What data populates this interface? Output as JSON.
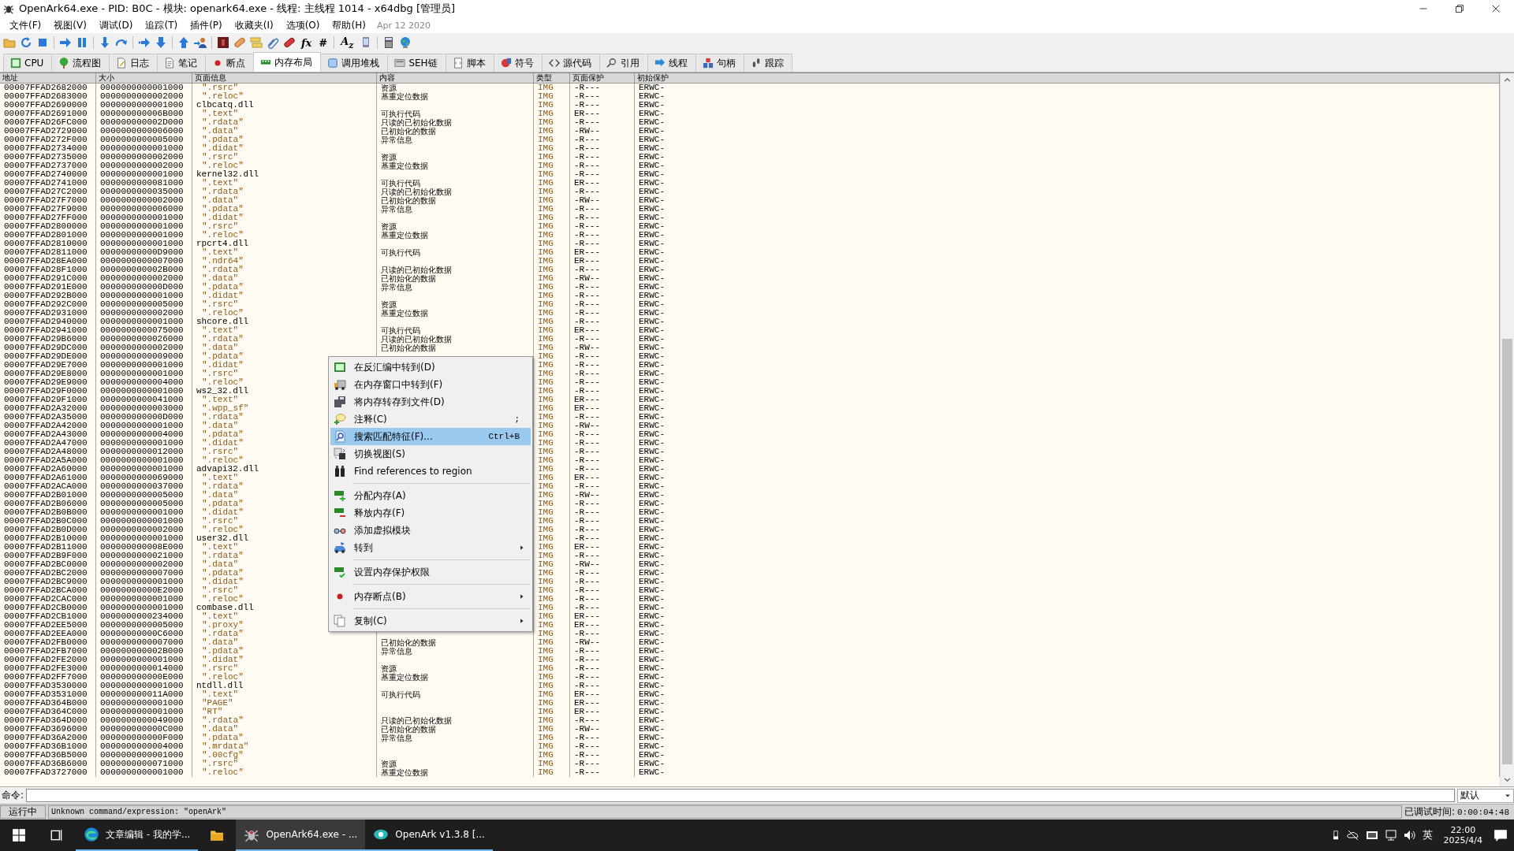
{
  "window": {
    "title": "OpenArk64.exe - PID: B0C - 模块: openark64.exe - 线程: 主线程 1014 - x64dbg [管理员]"
  },
  "menu_bar": {
    "items": [
      "文件(F)",
      "视图(V)",
      "调试(D)",
      "追踪(T)",
      "插件(P)",
      "收藏夹(I)",
      "选项(O)",
      "帮助(H)"
    ],
    "build_date": "Apr 12 2020"
  },
  "toolbar": [
    {
      "kind": "icon"
    },
    {
      "kind": "icon"
    },
    {
      "kind": "icon"
    },
    {
      "kind": "separator"
    },
    {
      "kind": "icon"
    },
    {
      "kind": "icon"
    },
    {
      "kind": "separator"
    },
    {
      "kind": "icon"
    },
    {
      "kind": "icon"
    },
    {
      "kind": "separator"
    },
    {
      "kind": "icon"
    },
    {
      "kind": "icon"
    },
    {
      "kind": "separator"
    },
    {
      "kind": "icon"
    },
    {
      "kind": "icon"
    },
    {
      "kind": "separator"
    },
    {
      "kind": "icon"
    },
    {
      "kind": "icon"
    },
    {
      "kind": "icon"
    },
    {
      "kind": "icon"
    },
    {
      "kind": "icon"
    },
    {
      "kind": "glyph",
      "text": "fx"
    },
    {
      "kind": "glyph",
      "text": "#"
    },
    {
      "kind": "separator"
    },
    {
      "kind": "glyph",
      "text": "A$_{z}$"
    },
    {
      "kind": "icon"
    },
    {
      "kind": "separator"
    },
    {
      "kind": "icon"
    },
    {
      "kind": "icon"
    }
  ],
  "tabs": [
    {
      "label": "CPU",
      "selected": false
    },
    {
      "label": "流程图",
      "selected": false
    },
    {
      "label": "日志",
      "selected": false
    },
    {
      "label": "笔记",
      "selected": false
    },
    {
      "label": "断点",
      "selected": false
    },
    {
      "label": "内存布局",
      "selected": true
    },
    {
      "label": "调用堆栈",
      "selected": false
    },
    {
      "label": "SEH链",
      "selected": false
    },
    {
      "label": "脚本",
      "selected": false
    },
    {
      "label": "符号",
      "selected": false
    },
    {
      "label": "源代码",
      "selected": false
    },
    {
      "label": "引用",
      "selected": false
    },
    {
      "label": "线程",
      "selected": false
    },
    {
      "label": "句柄",
      "selected": false
    },
    {
      "label": "跟踪",
      "selected": false
    }
  ],
  "table": {
    "columns": [
      "地址",
      "大小",
      "页面信息",
      "内容",
      "类型",
      "页面保护",
      "初始保护"
    ],
    "rows": [
      {
        "address": "00007FFAD2682000",
        "size": "0000000000001000",
        "info": "\".rsrc\"",
        "kind": "section",
        "content": "资源",
        "type": "IMG",
        "protection": "-R---",
        "initial": "ERWC-"
      },
      {
        "address": "00007FFAD2683000",
        "size": "0000000000002000",
        "info": "\".reloc\"",
        "kind": "section",
        "content": "基重定位数据",
        "type": "IMG",
        "protection": "-R---",
        "initial": "ERWC-"
      },
      {
        "address": "00007FFAD2690000",
        "size": "0000000000001000",
        "info": "clbcatq.dll",
        "kind": "module",
        "type": "IMG",
        "protection": "-R---",
        "initial": "ERWC-"
      },
      {
        "address": "00007FFAD2691000",
        "size": "000000000006B000",
        "info": "\".text\"",
        "kind": "section",
        "content": "可执行代码",
        "type": "IMG",
        "protection": "ER---",
        "initial": "ERWC-"
      },
      {
        "address": "00007FFAD26FC000",
        "size": "000000000002D000",
        "info": "\".rdata\"",
        "kind": "section",
        "content": "只读的已初始化数据",
        "type": "IMG",
        "protection": "-R---",
        "initial": "ERWC-"
      },
      {
        "address": "00007FFAD2729000",
        "size": "0000000000006000",
        "info": "\".data\"",
        "kind": "section",
        "content": "已初始化的数据",
        "type": "IMG",
        "protection": "-RW--",
        "initial": "ERWC-"
      },
      {
        "address": "00007FFAD272F000",
        "size": "0000000000005000",
        "info": "\".pdata\"",
        "kind": "section",
        "content": "异常信息",
        "type": "IMG",
        "protection": "-R---",
        "initial": "ERWC-"
      },
      {
        "address": "00007FFAD2734000",
        "size": "0000000000001000",
        "info": "\".didat\"",
        "kind": "section",
        "type": "IMG",
        "protection": "-R---",
        "initial": "ERWC-"
      },
      {
        "address": "00007FFAD2735000",
        "size": "0000000000002000",
        "info": "\".rsrc\"",
        "kind": "section",
        "content": "资源",
        "type": "IMG",
        "protection": "-R---",
        "initial": "ERWC-"
      },
      {
        "address": "00007FFAD2737000",
        "size": "0000000000002000",
        "info": "\".reloc\"",
        "kind": "section",
        "content": "基重定位数据",
        "type": "IMG",
        "protection": "-R---",
        "initial": "ERWC-"
      },
      {
        "address": "00007FFAD2740000",
        "size": "0000000000001000",
        "info": "kernel32.dll",
        "kind": "module",
        "type": "IMG",
        "protection": "-R---",
        "initial": "ERWC-"
      },
      {
        "address": "00007FFAD2741000",
        "size": "0000000000081000",
        "info": "\".text\"",
        "kind": "section",
        "content": "可执行代码",
        "type": "IMG",
        "protection": "ER---",
        "initial": "ERWC-"
      },
      {
        "address": "00007FFAD27C2000",
        "size": "0000000000035000",
        "info": "\".rdata\"",
        "kind": "section",
        "content": "只读的已初始化数据",
        "type": "IMG",
        "protection": "-R---",
        "initial": "ERWC-"
      },
      {
        "address": "00007FFAD27F7000",
        "size": "0000000000002000",
        "info": "\".data\"",
        "kind": "section",
        "content": "已初始化的数据",
        "type": "IMG",
        "protection": "-RW--",
        "initial": "ERWC-"
      },
      {
        "address": "00007FFAD27F9000",
        "size": "0000000000006000",
        "info": "\".pdata\"",
        "kind": "section",
        "content": "异常信息",
        "type": "IMG",
        "protection": "-R---",
        "initial": "ERWC-"
      },
      {
        "address": "00007FFAD27FF000",
        "size": "0000000000001000",
        "info": "\".didat\"",
        "kind": "section",
        "type": "IMG",
        "protection": "-R---",
        "initial": "ERWC-"
      },
      {
        "address": "00007FFAD2800000",
        "size": "0000000000001000",
        "info": "\".rsrc\"",
        "kind": "section",
        "content": "资源",
        "type": "IMG",
        "protection": "-R---",
        "initial": "ERWC-"
      },
      {
        "address": "00007FFAD2801000",
        "size": "0000000000001000",
        "info": "\".reloc\"",
        "kind": "section",
        "content": "基重定位数据",
        "type": "IMG",
        "protection": "-R---",
        "initial": "ERWC-"
      },
      {
        "address": "00007FFAD2810000",
        "size": "0000000000001000",
        "info": "rpcrt4.dll",
        "kind": "module",
        "type": "IMG",
        "protection": "-R---",
        "initial": "ERWC-"
      },
      {
        "address": "00007FFAD2811000",
        "size": "00000000000D9000",
        "info": "\".text\"",
        "kind": "section",
        "content": "可执行代码",
        "type": "IMG",
        "protection": "ER---",
        "initial": "ERWC-"
      },
      {
        "address": "00007FFAD28EA000",
        "size": "0000000000007000",
        "info": "\".ndr64\"",
        "kind": "section",
        "type": "IMG",
        "protection": "ER---",
        "initial": "ERWC-"
      },
      {
        "address": "00007FFAD28F1000",
        "size": "000000000002B000",
        "info": "\".rdata\"",
        "kind": "section",
        "content": "只读的已初始化数据",
        "type": "IMG",
        "protection": "-R---",
        "initial": "ERWC-"
      },
      {
        "address": "00007FFAD291C000",
        "size": "0000000000002000",
        "info": "\".data\"",
        "kind": "section",
        "content": "已初始化的数据",
        "type": "IMG",
        "protection": "-RW--",
        "initial": "ERWC-"
      },
      {
        "address": "00007FFAD291E000",
        "size": "000000000000D000",
        "info": "\".pdata\"",
        "kind": "section",
        "content": "异常信息",
        "type": "IMG",
        "protection": "-R---",
        "initial": "ERWC-"
      },
      {
        "address": "00007FFAD292B000",
        "size": "0000000000001000",
        "info": "\".didat\"",
        "kind": "section",
        "type": "IMG",
        "protection": "-R---",
        "initial": "ERWC-"
      },
      {
        "address": "00007FFAD292C000",
        "size": "0000000000005000",
        "info": "\".rsrc\"",
        "kind": "section",
        "content": "资源",
        "type": "IMG",
        "protection": "-R---",
        "initial": "ERWC-"
      },
      {
        "address": "00007FFAD2931000",
        "size": "0000000000002000",
        "info": "\".reloc\"",
        "kind": "section",
        "content": "基重定位数据",
        "type": "IMG",
        "protection": "-R---",
        "initial": "ERWC-"
      },
      {
        "address": "00007FFAD2940000",
        "size": "0000000000001000",
        "info": "shcore.dll",
        "kind": "module",
        "type": "IMG",
        "protection": "-R---",
        "initial": "ERWC-"
      },
      {
        "address": "00007FFAD2941000",
        "size": "0000000000075000",
        "info": "\".text\"",
        "kind": "section",
        "content": "可执行代码",
        "type": "IMG",
        "protection": "ER---",
        "initial": "ERWC-"
      },
      {
        "address": "00007FFAD29B6000",
        "size": "0000000000026000",
        "info": "\".rdata\"",
        "kind": "section",
        "content": "只读的已初始化数据",
        "type": "IMG",
        "protection": "-R---",
        "initial": "ERWC-"
      },
      {
        "address": "00007FFAD29DC000",
        "size": "0000000000002000",
        "info": "\".data\"",
        "kind": "section",
        "content": "已初始化的数据",
        "type": "IMG",
        "protection": "-RW--",
        "initial": "ERWC-"
      },
      {
        "address": "00007FFAD29DE000",
        "size": "0000000000009000",
        "info": "\".pdata\"",
        "kind": "section",
        "type": "IMG",
        "protection": "-R---",
        "initial": "ERWC-"
      },
      {
        "address": "00007FFAD29E7000",
        "size": "0000000000001000",
        "info": "\".didat\"",
        "kind": "section",
        "type": "IMG",
        "protection": "-R---",
        "initial": "ERWC-"
      },
      {
        "address": "00007FFAD29E8000",
        "size": "0000000000001000",
        "info": "\".rsrc\"",
        "kind": "section",
        "type": "IMG",
        "protection": "-R---",
        "initial": "ERWC-"
      },
      {
        "address": "00007FFAD29E9000",
        "size": "0000000000004000",
        "info": "\".reloc\"",
        "kind": "section",
        "type": "IMG",
        "protection": "-R---",
        "initial": "ERWC-"
      },
      {
        "address": "00007FFAD29F0000",
        "size": "0000000000001000",
        "info": "ws2_32.dll",
        "kind": "module",
        "type": "IMG",
        "protection": "-R---",
        "initial": "ERWC-"
      },
      {
        "address": "00007FFAD29F1000",
        "size": "0000000000041000",
        "info": "\".text\"",
        "kind": "section",
        "type": "IMG",
        "protection": "ER---",
        "initial": "ERWC-"
      },
      {
        "address": "00007FFAD2A32000",
        "size": "0000000000003000",
        "info": "\".wpp_sf\"",
        "kind": "section",
        "type": "IMG",
        "protection": "ER---",
        "initial": "ERWC-"
      },
      {
        "address": "00007FFAD2A35000",
        "size": "000000000000D000",
        "info": "\".rdata\"",
        "kind": "section",
        "type": "IMG",
        "protection": "-R---",
        "initial": "ERWC-"
      },
      {
        "address": "00007FFAD2A42000",
        "size": "0000000000001000",
        "info": "\".data\"",
        "kind": "section",
        "type": "IMG",
        "protection": "-RW--",
        "initial": "ERWC-"
      },
      {
        "address": "00007FFAD2A43000",
        "size": "0000000000004000",
        "info": "\".pdata\"",
        "kind": "section",
        "type": "IMG",
        "protection": "-R---",
        "initial": "ERWC-"
      },
      {
        "address": "00007FFAD2A47000",
        "size": "0000000000001000",
        "info": "\".didat\"",
        "kind": "section",
        "type": "IMG",
        "protection": "-R---",
        "initial": "ERWC-"
      },
      {
        "address": "00007FFAD2A48000",
        "size": "0000000000012000",
        "info": "\".rsrc\"",
        "kind": "section",
        "type": "IMG",
        "protection": "-R---",
        "initial": "ERWC-"
      },
      {
        "address": "00007FFAD2A5A000",
        "size": "0000000000001000",
        "info": "\".reloc\"",
        "kind": "section",
        "type": "IMG",
        "protection": "-R---",
        "initial": "ERWC-"
      },
      {
        "address": "00007FFAD2A60000",
        "size": "0000000000001000",
        "info": "advapi32.dll",
        "kind": "module",
        "type": "IMG",
        "protection": "-R---",
        "initial": "ERWC-"
      },
      {
        "address": "00007FFAD2A61000",
        "size": "0000000000069000",
        "info": "\".text\"",
        "kind": "section",
        "type": "IMG",
        "protection": "ER---",
        "initial": "ERWC-"
      },
      {
        "address": "00007FFAD2ACA000",
        "size": "0000000000037000",
        "info": "\".rdata\"",
        "kind": "section",
        "type": "IMG",
        "protection": "-R---",
        "initial": "ERWC-"
      },
      {
        "address": "00007FFAD2B01000",
        "size": "0000000000005000",
        "info": "\".data\"",
        "kind": "section",
        "type": "IMG",
        "protection": "-RW--",
        "initial": "ERWC-"
      },
      {
        "address": "00007FFAD2B06000",
        "size": "0000000000005000",
        "info": "\".pdata\"",
        "kind": "section",
        "type": "IMG",
        "protection": "-R---",
        "initial": "ERWC-"
      },
      {
        "address": "00007FFAD2B0B000",
        "size": "0000000000001000",
        "info": "\".didat\"",
        "kind": "section",
        "type": "IMG",
        "protection": "-R---",
        "initial": "ERWC-"
      },
      {
        "address": "00007FFAD2B0C000",
        "size": "0000000000001000",
        "info": "\".rsrc\"",
        "kind": "section",
        "type": "IMG",
        "protection": "-R---",
        "initial": "ERWC-"
      },
      {
        "address": "00007FFAD2B0D000",
        "size": "0000000000002000",
        "info": "\".reloc\"",
        "kind": "section",
        "type": "IMG",
        "protection": "-R---",
        "initial": "ERWC-"
      },
      {
        "address": "00007FFAD2B10000",
        "size": "0000000000001000",
        "info": "user32.dll",
        "kind": "module",
        "type": "IMG",
        "protection": "-R---",
        "initial": "ERWC-"
      },
      {
        "address": "00007FFAD2B11000",
        "size": "000000000008E000",
        "info": "\".text\"",
        "kind": "section",
        "type": "IMG",
        "protection": "ER---",
        "initial": "ERWC-"
      },
      {
        "address": "00007FFAD2B9F000",
        "size": "0000000000021000",
        "info": "\".rdata\"",
        "kind": "section",
        "type": "IMG",
        "protection": "-R---",
        "initial": "ERWC-"
      },
      {
        "address": "00007FFAD2BC0000",
        "size": "0000000000002000",
        "info": "\".data\"",
        "kind": "section",
        "type": "IMG",
        "protection": "-RW--",
        "initial": "ERWC-"
      },
      {
        "address": "00007FFAD2BC2000",
        "size": "0000000000007000",
        "info": "\".pdata\"",
        "kind": "section",
        "type": "IMG",
        "protection": "-R---",
        "initial": "ERWC-"
      },
      {
        "address": "00007FFAD2BC9000",
        "size": "0000000000001000",
        "info": "\".didat\"",
        "kind": "section",
        "type": "IMG",
        "protection": "-R---",
        "initial": "ERWC-"
      },
      {
        "address": "00007FFAD2BCA000",
        "size": "00000000000E2000",
        "info": "\".rsrc\"",
        "kind": "section",
        "type": "IMG",
        "protection": "-R---",
        "initial": "ERWC-"
      },
      {
        "address": "00007FFAD2CAC000",
        "size": "0000000000001000",
        "info": "\".reloc\"",
        "kind": "section",
        "type": "IMG",
        "protection": "-R---",
        "initial": "ERWC-"
      },
      {
        "address": "00007FFAD2CB0000",
        "size": "0000000000001000",
        "info": "combase.dll",
        "kind": "module",
        "type": "IMG",
        "protection": "-R---",
        "initial": "ERWC-"
      },
      {
        "address": "00007FFAD2CB1000",
        "size": "0000000000234000",
        "info": "\".text\"",
        "kind": "section",
        "type": "IMG",
        "protection": "ER---",
        "initial": "ERWC-"
      },
      {
        "address": "00007FFAD2EE5000",
        "size": "0000000000005000",
        "info": "\".proxy\"",
        "kind": "section",
        "type": "IMG",
        "protection": "ER---",
        "initial": "ERWC-"
      },
      {
        "address": "00007FFAD2EEA000",
        "size": "00000000000C6000",
        "info": "\".rdata\"",
        "kind": "section",
        "type": "IMG",
        "protection": "-R---",
        "initial": "ERWC-"
      },
      {
        "address": "00007FFAD2FB0000",
        "size": "0000000000007000",
        "info": "\".data\"",
        "kind": "section",
        "content": "已初始化的数据",
        "type": "IMG",
        "protection": "-RW--",
        "initial": "ERWC-"
      },
      {
        "address": "00007FFAD2FB7000",
        "size": "000000000002B000",
        "info": "\".pdata\"",
        "kind": "section",
        "content": "异常信息",
        "type": "IMG",
        "protection": "-R---",
        "initial": "ERWC-"
      },
      {
        "address": "00007FFAD2FE2000",
        "size": "0000000000001000",
        "info": "\".didat\"",
        "kind": "section",
        "type": "IMG",
        "protection": "-R---",
        "initial": "ERWC-"
      },
      {
        "address": "00007FFAD2FE3000",
        "size": "0000000000014000",
        "info": "\".rsrc\"",
        "kind": "section",
        "content": "资源",
        "type": "IMG",
        "protection": "-R---",
        "initial": "ERWC-"
      },
      {
        "address": "00007FFAD2FF7000",
        "size": "000000000000E000",
        "info": "\".reloc\"",
        "kind": "section",
        "content": "基重定位数据",
        "type": "IMG",
        "protection": "-R---",
        "initial": "ERWC-"
      },
      {
        "address": "00007FFAD3530000",
        "size": "0000000000001000",
        "info": "ntdll.dll",
        "kind": "module",
        "type": "IMG",
        "protection": "-R---",
        "initial": "ERWC-"
      },
      {
        "address": "00007FFAD3531000",
        "size": "000000000011A000",
        "info": "\".text\"",
        "kind": "section",
        "content": "可执行代码",
        "type": "IMG",
        "protection": "ER---",
        "initial": "ERWC-"
      },
      {
        "address": "00007FFAD364B000",
        "size": "0000000000001000",
        "info": "\"PAGE\"",
        "kind": "section",
        "type": "IMG",
        "protection": "ER---",
        "initial": "ERWC-"
      },
      {
        "address": "00007FFAD364C000",
        "size": "0000000000001000",
        "info": "\"RT\"",
        "kind": "section",
        "type": "IMG",
        "protection": "ER---",
        "initial": "ERWC-"
      },
      {
        "address": "00007FFAD364D000",
        "size": "0000000000049000",
        "info": "\".rdata\"",
        "kind": "section",
        "content": "只读的已初始化数据",
        "type": "IMG",
        "protection": "-R---",
        "initial": "ERWC-"
      },
      {
        "address": "00007FFAD3696000",
        "size": "000000000000C000",
        "info": "\".data\"",
        "kind": "section",
        "content": "已初始化的数据",
        "type": "IMG",
        "protection": "-RW--",
        "initial": "ERWC-"
      },
      {
        "address": "00007FFAD36A2000",
        "size": "000000000000F000",
        "info": "\".pdata\"",
        "kind": "section",
        "content": "异常信息",
        "type": "IMG",
        "protection": "-R---",
        "initial": "ERWC-"
      },
      {
        "address": "00007FFAD36B1000",
        "size": "0000000000004000",
        "info": "\".mrdata\"",
        "kind": "section",
        "type": "IMG",
        "protection": "-R---",
        "initial": "ERWC-"
      },
      {
        "address": "00007FFAD36B5000",
        "size": "0000000000001000",
        "info": "\".00cfg\"",
        "kind": "section",
        "type": "IMG",
        "protection": "-R---",
        "initial": "ERWC-"
      },
      {
        "address": "00007FFAD36B6000",
        "size": "0000000000071000",
        "info": "\".rsrc\"",
        "kind": "section",
        "content": "资源",
        "type": "IMG",
        "protection": "-R---",
        "initial": "ERWC-"
      },
      {
        "address": "00007FFAD3727000",
        "size": "0000000000001000",
        "info": "\".reloc\"",
        "kind": "section",
        "content": "基重定位数据",
        "type": "IMG",
        "protection": "-R---",
        "initial": "ERWC-"
      }
    ]
  },
  "context_menu": [
    {
      "kind": "item",
      "label": "在反汇编中转到(D)",
      "submenu": false,
      "selected": false
    },
    {
      "kind": "item",
      "label": "在内存窗口中转到(F)",
      "submenu": false,
      "selected": false
    },
    {
      "kind": "item",
      "label": "将内存转存到文件(D)",
      "submenu": false,
      "selected": false
    },
    {
      "kind": "item",
      "label": "注释(C)",
      "shortcut": ";",
      "submenu": false,
      "selected": false
    },
    {
      "kind": "item",
      "label": "搜索匹配特征(F)...",
      "shortcut": "Ctrl+B",
      "submenu": false,
      "selected": true
    },
    {
      "kind": "item",
      "label": "切换视图(S)",
      "submenu": false,
      "selected": false
    },
    {
      "kind": "item",
      "label": "Find references to region",
      "submenu": false,
      "selected": false
    },
    {
      "kind": "separator"
    },
    {
      "kind": "item",
      "label": "分配内存(A)",
      "submenu": false,
      "selected": false
    },
    {
      "kind": "item",
      "label": "释放内存(F)",
      "submenu": false,
      "selected": false
    },
    {
      "kind": "item",
      "label": "添加虚拟模块",
      "submenu": false,
      "selected": false
    },
    {
      "kind": "item",
      "label": "转到",
      "submenu": true,
      "selected": false
    },
    {
      "kind": "separator"
    },
    {
      "kind": "item",
      "label": "设置内存保护权限",
      "submenu": false,
      "selected": false
    },
    {
      "kind": "separator"
    },
    {
      "kind": "item",
      "label": "内存断点(B)",
      "submenu": true,
      "selected": false
    },
    {
      "kind": "separator"
    },
    {
      "kind": "item",
      "label": "复制(C)",
      "submenu": true,
      "selected": false
    }
  ],
  "command_bar": {
    "label": "命令:",
    "mode": "默认"
  },
  "status_bar": {
    "state": "运行中",
    "message": "Unknown command/expression: \"openArk\"",
    "time_label": "已调试时间:",
    "time": "0:00:04:48"
  },
  "taskbar": {
    "items": [
      {
        "kind": "start"
      },
      {
        "kind": "task-view"
      },
      {
        "kind": "browser",
        "label": "文章编辑 - 我的学...",
        "selected": false
      },
      {
        "kind": "folder"
      },
      {
        "kind": "debugger",
        "label": "OpenArk64.exe - ...",
        "selected": true
      },
      {
        "kind": "openark",
        "label": "OpenArk v1.3.8 [...",
        "selected": false
      }
    ],
    "ime": "英",
    "time": "22:00",
    "date": "2025/4/4"
  }
}
